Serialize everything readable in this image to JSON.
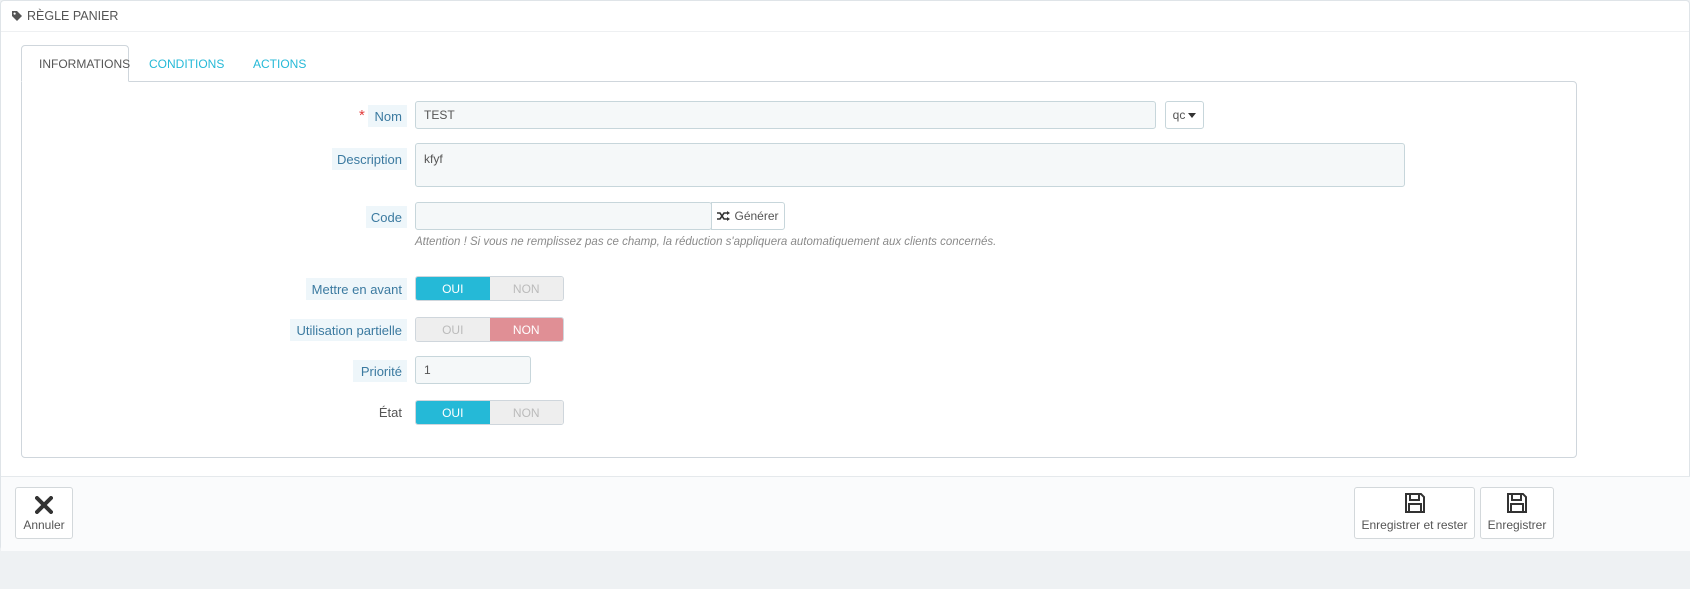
{
  "panel": {
    "heading_icon": "tag-icon",
    "heading": "RÈGLE PANIER"
  },
  "tabs": [
    {
      "label": "INFORMATIONS",
      "icon": "info-icon",
      "active": true
    },
    {
      "label": "CONDITIONS",
      "icon": "random-icon",
      "active": false
    },
    {
      "label": "ACTIONS",
      "icon": "wrench-icon",
      "active": false
    }
  ],
  "form": {
    "name": {
      "label": "Nom",
      "required_mark": "*",
      "value": "TEST",
      "lang": "qc"
    },
    "description": {
      "label": "Description",
      "value": "kfyf"
    },
    "code": {
      "label": "Code",
      "value": "",
      "generate_label": "Générer",
      "help": "Attention ! Si vous ne remplissez pas ce champ, la réduction s'appliquera automatiquement aux clients concernés."
    },
    "highlight": {
      "label": "Mettre en avant",
      "yes": "OUI",
      "no": "NON",
      "selected": "OUI"
    },
    "partial_use": {
      "label": "Utilisation partielle",
      "yes": "OUI",
      "no": "NON",
      "selected": "NON"
    },
    "priority": {
      "label": "Priorité",
      "value": "1"
    },
    "status": {
      "label": "État",
      "yes": "OUI",
      "no": "NON",
      "selected": "OUI"
    }
  },
  "footer": {
    "cancel": "Annuler",
    "save_and_stay": "Enregistrer et rester",
    "save": "Enregistrer"
  },
  "colors": {
    "accent": "#25b9d7",
    "switch_no_red": "#e08f95",
    "required": "#e23b3b"
  }
}
